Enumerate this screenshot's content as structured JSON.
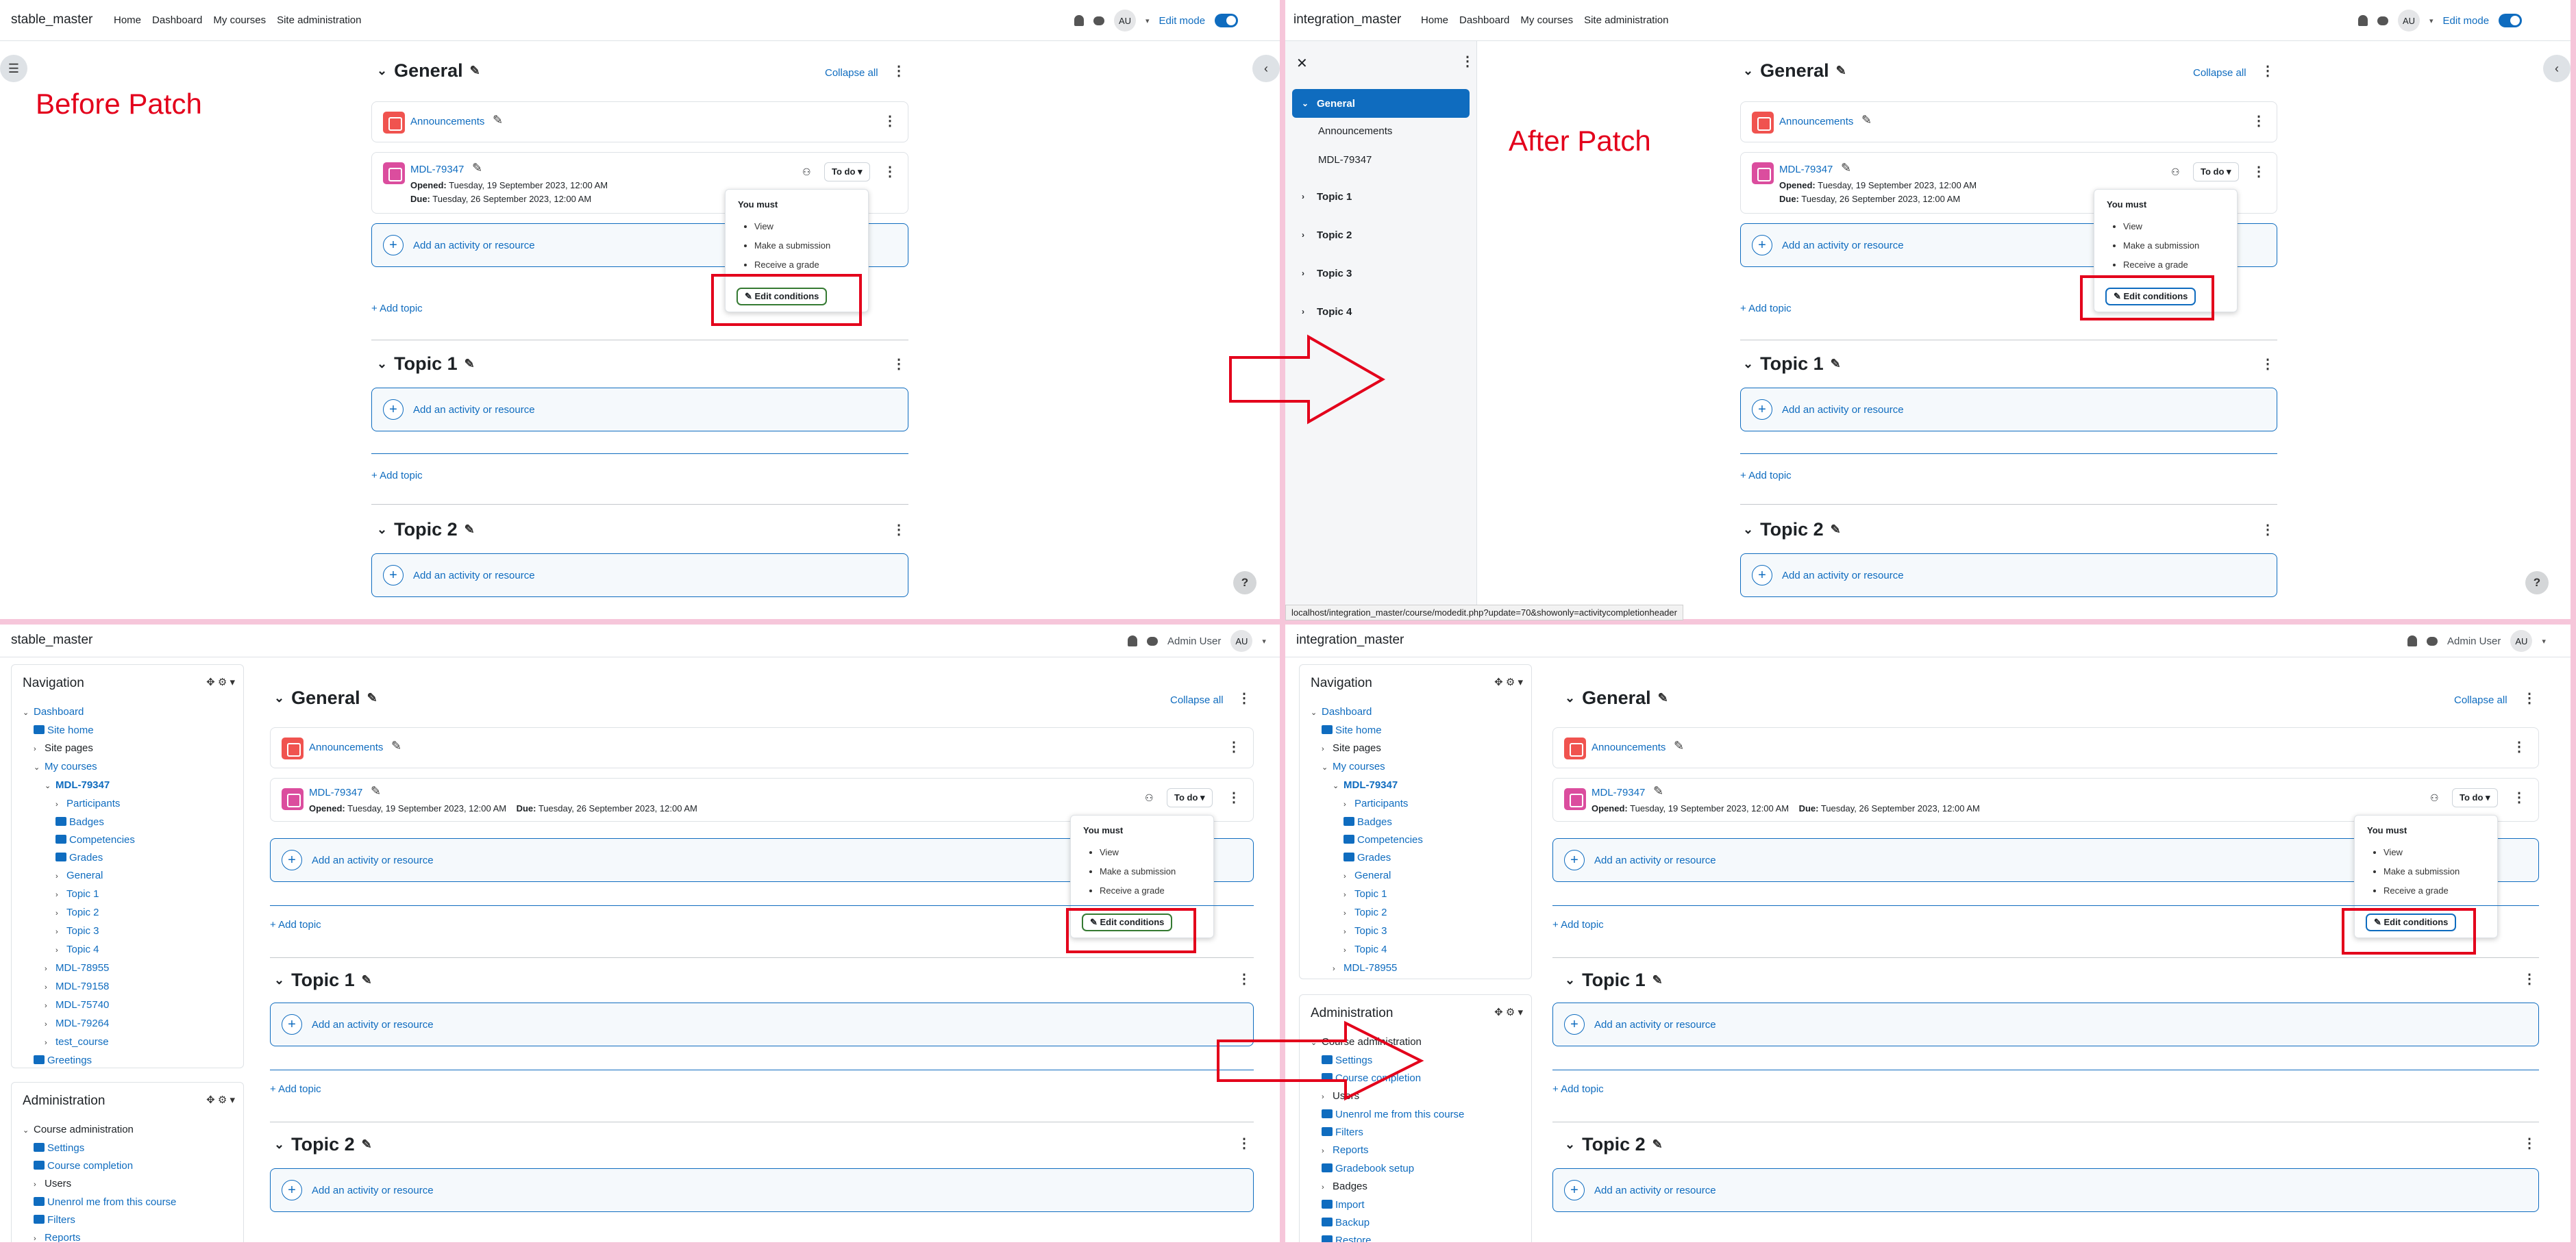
{
  "before": {
    "site_name": "stable_master",
    "menu": [
      "Home",
      "Dashboard",
      "My courses",
      "Site administration"
    ],
    "edit_mode_label": "Edit mode",
    "avatar_initials": "AU",
    "annotation": "Before Patch"
  },
  "after": {
    "site_name": "integration_master",
    "menu": [
      "Home",
      "Dashboard",
      "My courses",
      "Site administration"
    ],
    "edit_mode_label": "Edit mode",
    "avatar_initials": "AU",
    "annotation": "After Patch",
    "course_index": {
      "sections": [
        {
          "label": "General",
          "active": true
        },
        {
          "label": "Announcements",
          "sub": true
        },
        {
          "label": "MDL-79347",
          "sub": true
        },
        {
          "label": "Topic 1"
        },
        {
          "label": "Topic 2"
        },
        {
          "label": "Topic 3"
        },
        {
          "label": "Topic 4"
        }
      ]
    },
    "status_url": "localhost/integration_master/course/modedit.php?update=70&showonly=activitycompletionheader"
  },
  "course": {
    "collapse_all": "Collapse all",
    "general_title": "General",
    "forum_name": "Announcements",
    "assign_name": "MDL-79347",
    "opened_label": "Opened:",
    "opened_value": "Tuesday, 19 September 2023, 12:00 AM",
    "due_label": "Due:",
    "due_value": "Tuesday, 26 September 2023, 12:00 AM",
    "todo_label": "To do",
    "add_activity": "Add an activity or resource",
    "add_topic": "Add topic",
    "topic1": "Topic 1",
    "topic2": "Topic 2",
    "help": "?"
  },
  "completion_popup": {
    "title": "You must",
    "items": [
      "View",
      "Make a submission",
      "Receive a grade"
    ],
    "edit_button": "Edit conditions"
  },
  "classic_before": {
    "site_name": "stable_master",
    "user_name": "Admin User",
    "avatar_initials": "AU",
    "navigation_title": "Navigation",
    "nav_tree": [
      {
        "t": "Dashboard",
        "lvl": 0,
        "tri": "v",
        "link": true
      },
      {
        "t": "Site home",
        "lvl": 1,
        "icon": true,
        "link": true
      },
      {
        "t": "Site pages",
        "lvl": 1,
        "tri": ">",
        "link": false
      },
      {
        "t": "My courses",
        "lvl": 1,
        "tri": "v",
        "link": true
      },
      {
        "t": "MDL-79347",
        "lvl": 2,
        "tri": "v",
        "link": true,
        "bold": true
      },
      {
        "t": "Participants",
        "lvl": 3,
        "tri": ">",
        "link": true
      },
      {
        "t": "Badges",
        "lvl": 3,
        "icon": true,
        "link": true
      },
      {
        "t": "Competencies",
        "lvl": 3,
        "icon": true,
        "link": true
      },
      {
        "t": "Grades",
        "lvl": 3,
        "icon": true,
        "link": true
      },
      {
        "t": "General",
        "lvl": 3,
        "tri": ">",
        "link": true
      },
      {
        "t": "Topic 1",
        "lvl": 3,
        "tri": ">",
        "link": true
      },
      {
        "t": "Topic 2",
        "lvl": 3,
        "tri": ">",
        "link": true
      },
      {
        "t": "Topic 3",
        "lvl": 3,
        "tri": ">",
        "link": true
      },
      {
        "t": "Topic 4",
        "lvl": 3,
        "tri": ">",
        "link": true
      },
      {
        "t": "MDL-78955",
        "lvl": 2,
        "tri": ">",
        "link": true
      },
      {
        "t": "MDL-79158",
        "lvl": 2,
        "tri": ">",
        "link": true
      },
      {
        "t": "MDL-75740",
        "lvl": 2,
        "tri": ">",
        "link": true
      },
      {
        "t": "MDL-79264",
        "lvl": 2,
        "tri": ">",
        "link": true
      },
      {
        "t": "test_course",
        "lvl": 2,
        "tri": ">",
        "link": true
      },
      {
        "t": "Greetings",
        "lvl": 1,
        "icon": true,
        "link": true
      }
    ],
    "admin_title": "Administration",
    "admin_tree": [
      {
        "t": "Course administration",
        "lvl": 0,
        "tri": "v",
        "link": false
      },
      {
        "t": "Settings",
        "lvl": 1,
        "icon": true,
        "link": true
      },
      {
        "t": "Course completion",
        "lvl": 1,
        "icon": true,
        "link": true
      },
      {
        "t": "Users",
        "lvl": 1,
        "tri": ">",
        "link": false
      },
      {
        "t": "Unenrol me from this course",
        "lvl": 1,
        "icon": true,
        "link": true
      },
      {
        "t": "Filters",
        "lvl": 1,
        "icon": true,
        "link": true
      },
      {
        "t": "Reports",
        "lvl": 1,
        "tri": ">",
        "link": true
      }
    ]
  },
  "classic_after": {
    "site_name": "integration_master",
    "user_name": "Admin User",
    "avatar_initials": "AU",
    "navigation_title": "Navigation",
    "nav_tree": [
      {
        "t": "Dashboard",
        "lvl": 0,
        "tri": "v",
        "link": true
      },
      {
        "t": "Site home",
        "lvl": 1,
        "icon": true,
        "link": true
      },
      {
        "t": "Site pages",
        "lvl": 1,
        "tri": ">",
        "link": false
      },
      {
        "t": "My courses",
        "lvl": 1,
        "tri": "v",
        "link": true
      },
      {
        "t": "MDL-79347",
        "lvl": 2,
        "tri": "v",
        "link": true,
        "bold": true
      },
      {
        "t": "Participants",
        "lvl": 3,
        "tri": ">",
        "link": true
      },
      {
        "t": "Badges",
        "lvl": 3,
        "icon": true,
        "link": true
      },
      {
        "t": "Competencies",
        "lvl": 3,
        "icon": true,
        "link": true
      },
      {
        "t": "Grades",
        "lvl": 3,
        "icon": true,
        "link": true
      },
      {
        "t": "General",
        "lvl": 3,
        "tri": ">",
        "link": true
      },
      {
        "t": "Topic 1",
        "lvl": 3,
        "tri": ">",
        "link": true
      },
      {
        "t": "Topic 2",
        "lvl": 3,
        "tri": ">",
        "link": true
      },
      {
        "t": "Topic 3",
        "lvl": 3,
        "tri": ">",
        "link": true
      },
      {
        "t": "Topic 4",
        "lvl": 3,
        "tri": ">",
        "link": true
      },
      {
        "t": "MDL-78955",
        "lvl": 2,
        "tri": ">",
        "link": true
      }
    ],
    "admin_title": "Administration",
    "admin_tree": [
      {
        "t": "Course administration",
        "lvl": 0,
        "tri": "v",
        "link": false
      },
      {
        "t": "Settings",
        "lvl": 1,
        "icon": true,
        "link": true
      },
      {
        "t": "Course completion",
        "lvl": 1,
        "icon": true,
        "link": true
      },
      {
        "t": "Users",
        "lvl": 1,
        "tri": ">",
        "link": false
      },
      {
        "t": "Unenrol me from this course",
        "lvl": 1,
        "icon": true,
        "link": true
      },
      {
        "t": "Filters",
        "lvl": 1,
        "icon": true,
        "link": true
      },
      {
        "t": "Reports",
        "lvl": 1,
        "tri": ">",
        "link": true
      },
      {
        "t": "Gradebook setup",
        "lvl": 1,
        "icon": true,
        "link": true
      },
      {
        "t": "Badges",
        "lvl": 1,
        "tri": ">",
        "link": false
      },
      {
        "t": "Import",
        "lvl": 1,
        "icon": true,
        "link": true
      },
      {
        "t": "Backup",
        "lvl": 1,
        "icon": true,
        "link": true
      },
      {
        "t": "Restore",
        "lvl": 1,
        "icon": true,
        "link": true
      }
    ]
  }
}
